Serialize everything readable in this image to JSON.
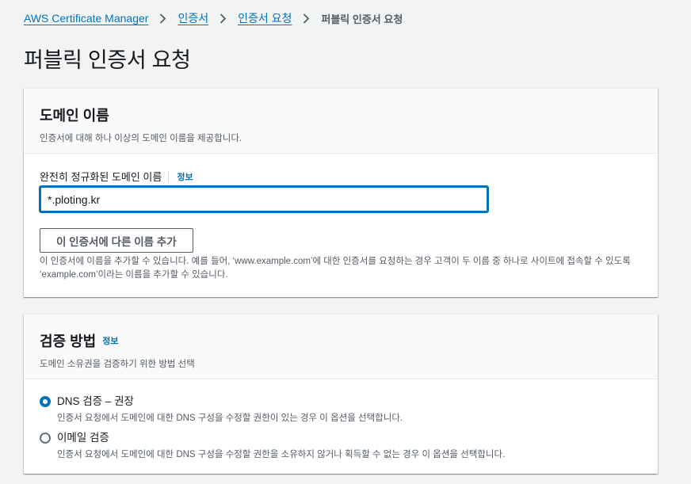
{
  "breadcrumb": {
    "items": [
      "AWS Certificate Manager",
      "인증서",
      "인증서 요청"
    ],
    "current": "퍼블릭 인증서 요청"
  },
  "page_title": "퍼블릭 인증서 요청",
  "domain_section": {
    "title": "도메인 이름",
    "description": "인증서에 대해 하나 이상의 도메인 이름을 제공합니다.",
    "field_label": "완전히 정규화된 도메인 이름",
    "info_label": "정보",
    "input_value": "*.ploting.kr",
    "add_button_label": "이 인증서에 다른 이름 추가",
    "help_line1": "이 인증서에 이름을 추가할 수 있습니다. 예를 들어, ‘www.example.com’에 대한 인증서를 요청하는 경우 고객이 두 이름 중 하나로 사이트에 접속할 수 있도록",
    "help_line2": "‘example.com’이라는 이름을 추가할 수 있습니다."
  },
  "validation_section": {
    "title": "검증 방법",
    "info_label": "정보",
    "description": "도메인 소유권을 검증하기 위한 방법 선택",
    "options": [
      {
        "label": "DNS 검증 – 권장",
        "description": "인증서 요청에서 도메인에 대한 DNS 구성을 수정할 권한이 있는 경우 이 옵션을 선택합니다.",
        "selected": true
      },
      {
        "label": "이메일 검증",
        "description": "인증서 요청에서 도메인에 대한 DNS 구성을 수정할 권한을 소유하지 않거나 획득할 수 없는 경우 이 옵션을 선택합니다.",
        "selected": false
      }
    ]
  },
  "colors": {
    "link": "#0073bb",
    "background": "#f2f3f3",
    "text": "#16191f",
    "secondary_text": "#545b64"
  }
}
